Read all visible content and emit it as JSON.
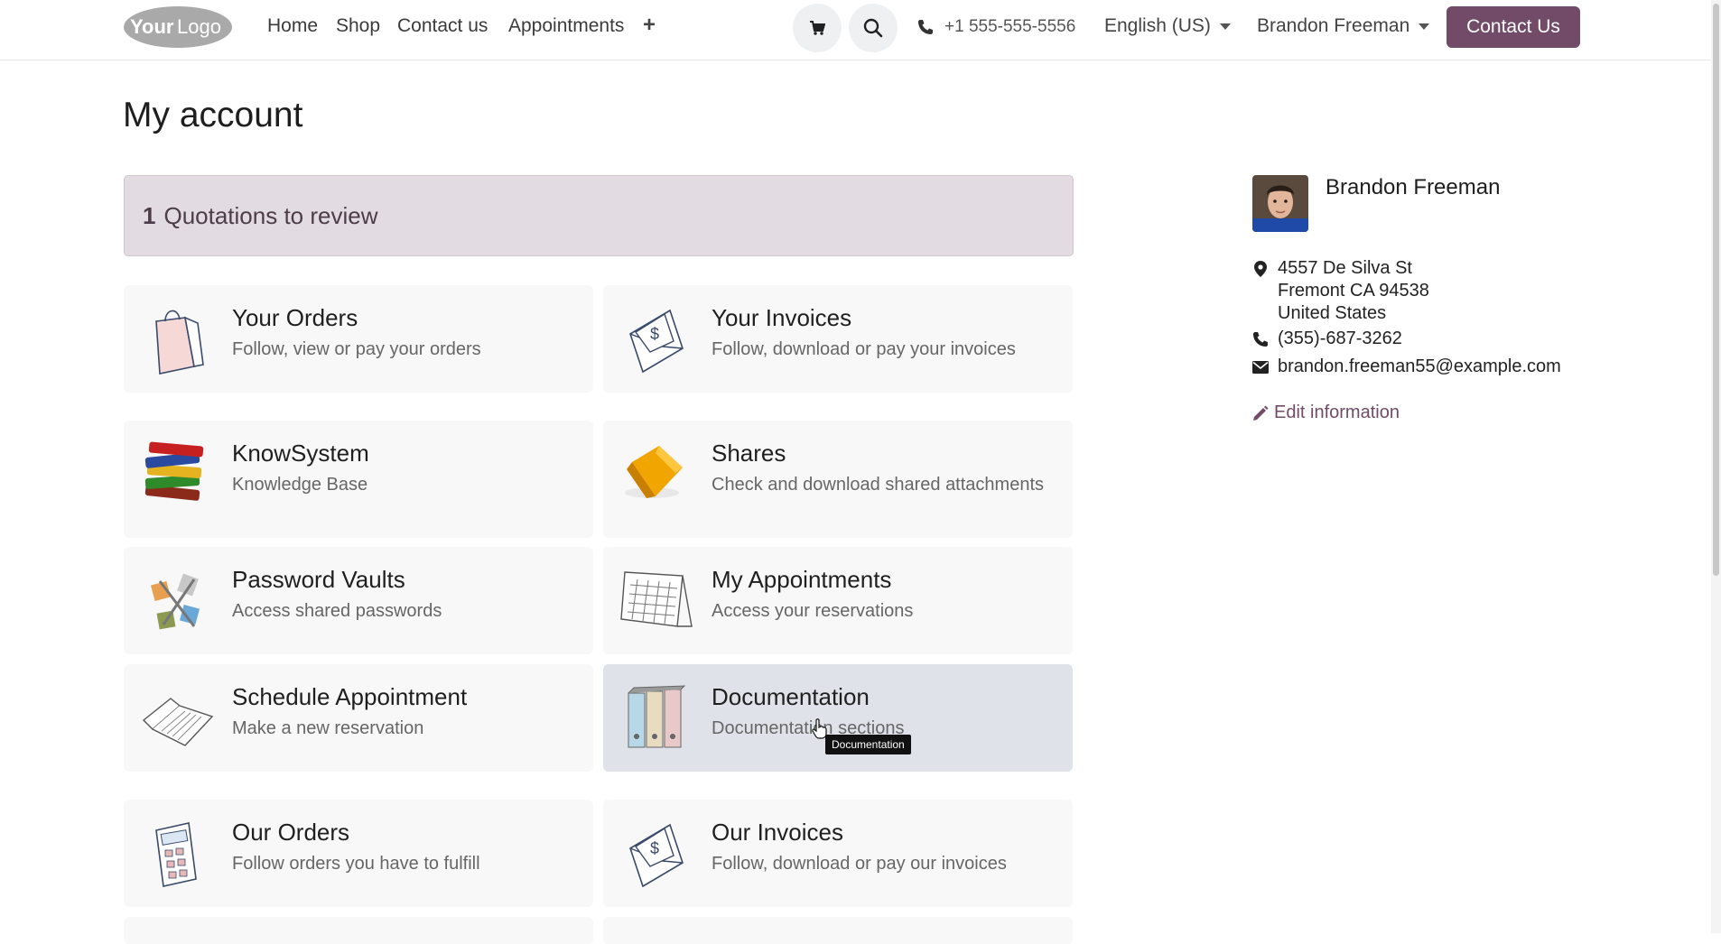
{
  "header": {
    "logo_text": "YourLogo",
    "nav": [
      "Home",
      "Shop",
      "Contact us",
      "Appointments"
    ],
    "phone": "+1 555-555-5556",
    "language": "English (US)",
    "user_menu": "Brandon Freeman",
    "contact_button": "Contact Us"
  },
  "page": {
    "title": "My account",
    "alert_count": "1",
    "alert_text": "Quotations to review"
  },
  "cards": [
    {
      "title": "Your Orders",
      "desc": "Follow, view or pay your orders",
      "icon": "shopping-bag-icon"
    },
    {
      "title": "Your Invoices",
      "desc": "Follow, download or pay your invoices",
      "icon": "invoice-envelope-icon"
    },
    {
      "title": "KnowSystem",
      "desc": "Knowledge Base",
      "icon": "books-icon"
    },
    {
      "title": "Shares",
      "desc": "Check and download shared attachments",
      "icon": "shared-folder-icon"
    },
    {
      "title": "Password Vaults",
      "desc": "Access shared passwords",
      "icon": "password-vault-icon"
    },
    {
      "title": "My Appointments",
      "desc": "Access your reservations",
      "icon": "calendar-icon"
    },
    {
      "title": "Schedule Appointment",
      "desc": "Make a new reservation",
      "icon": "open-book-icon"
    },
    {
      "title": "Documentation",
      "desc": "Documentation sections",
      "icon": "binders-icon"
    },
    {
      "title": "Our Orders",
      "desc": "Follow orders you have to fulfill",
      "icon": "calculator-icon"
    },
    {
      "title": "Our Invoices",
      "desc": "Follow, download or pay our invoices",
      "icon": "invoice-envelope-icon"
    }
  ],
  "tooltip": "Documentation",
  "profile": {
    "name": "Brandon Freeman",
    "address_line1": "4557 De Silva St",
    "address_line2": "Fremont CA 94538",
    "address_line3": "United States",
    "phone": "(355)-687-3262",
    "email": "brandon.freeman55@example.com",
    "edit_label": "Edit information"
  },
  "colors": {
    "brand": "#714b67",
    "alert_bg": "#e3dbe2",
    "card_bg": "#f8f8f9",
    "card_hover_bg": "#dfe3e9"
  }
}
